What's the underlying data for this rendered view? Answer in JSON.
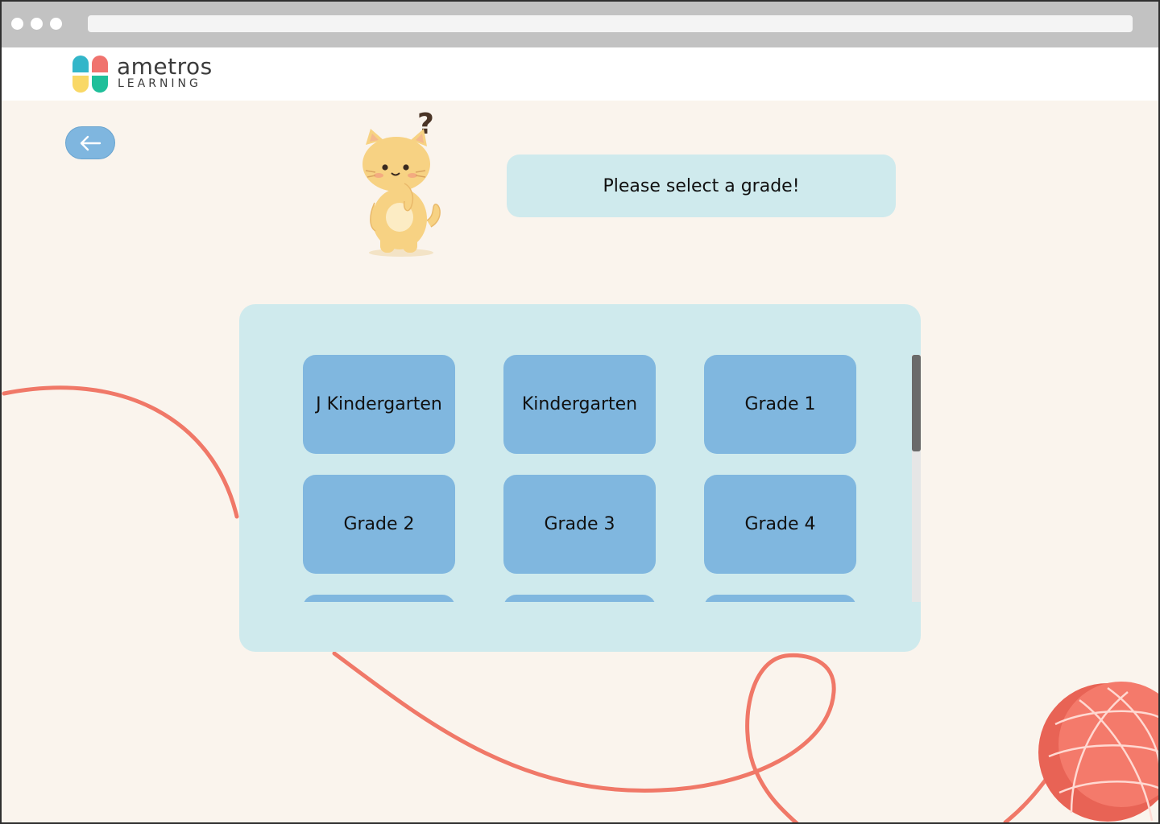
{
  "brand": {
    "name": "ametros",
    "subtitle": "LEARNING",
    "colors": [
      "#33b6c9",
      "#f0736e",
      "#f9d866",
      "#1fbf9a"
    ]
  },
  "nav": {
    "back_icon": "arrow-left-icon"
  },
  "mascot": {
    "icon": "thinking-cat-icon",
    "mark": "?"
  },
  "prompt": {
    "text": "Please select a grade!"
  },
  "grades": [
    {
      "label": "J Kindergarten"
    },
    {
      "label": "Kindergarten"
    },
    {
      "label": "Grade 1"
    },
    {
      "label": "Grade 2"
    },
    {
      "label": "Grade 3"
    },
    {
      "label": "Grade 4"
    },
    {
      "label": ""
    },
    {
      "label": ""
    },
    {
      "label": ""
    }
  ],
  "colors": {
    "page_bg": "#faf4ed",
    "panel_bg": "#cfeaed",
    "button_bg": "#80b7df",
    "yarn": "#f07868"
  }
}
